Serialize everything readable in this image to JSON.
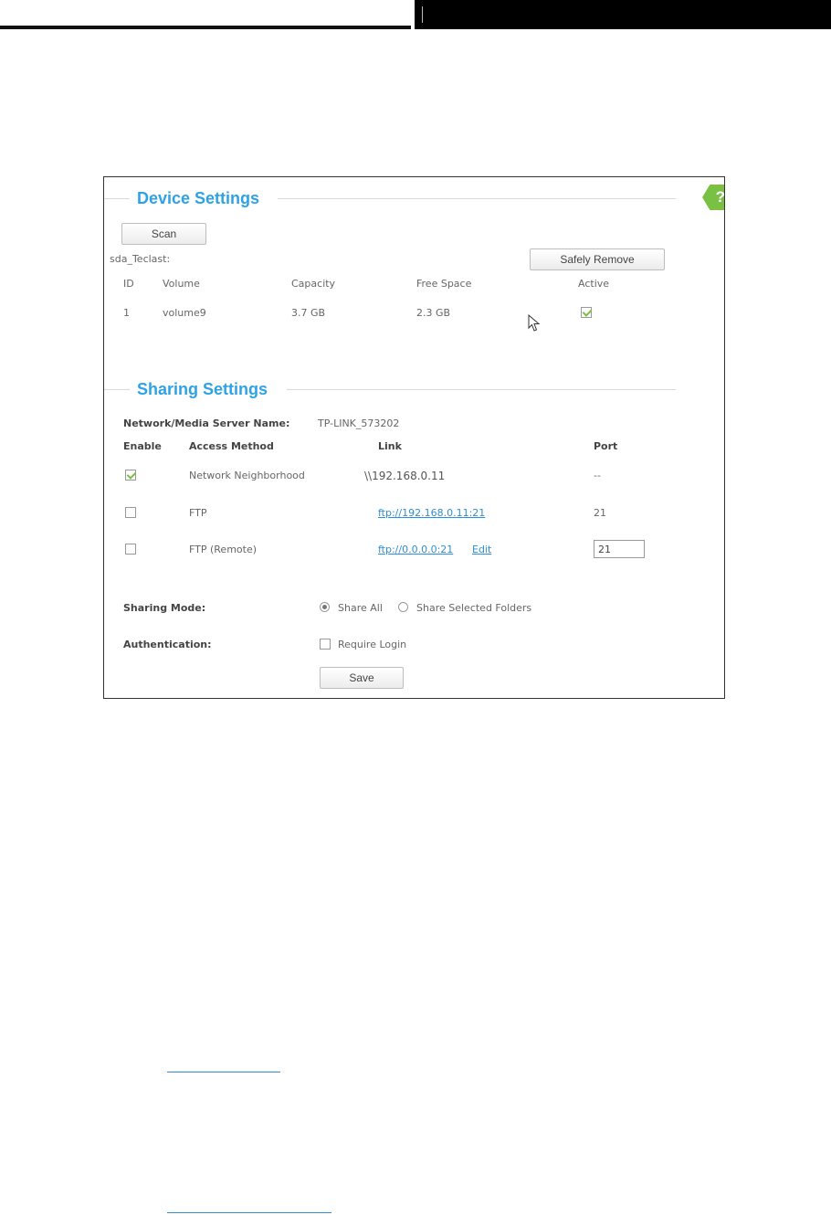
{
  "device_settings": {
    "title": "Device Settings",
    "scan_label": "Scan",
    "device_name": "sda_Teclast:",
    "safely_remove_label": "Safely Remove",
    "columns": {
      "id": "ID",
      "volume": "Volume",
      "capacity": "Capacity",
      "free_space": "Free Space",
      "active": "Active"
    },
    "rows": [
      {
        "id": "1",
        "volume": "volume9",
        "capacity": "3.7 GB",
        "free_space": "2.3 GB",
        "active": true
      }
    ]
  },
  "sharing_settings": {
    "title": "Sharing Settings",
    "server_name_label": "Network/Media Server Name:",
    "server_name_value": "TP-LINK_573202",
    "columns": {
      "enable": "Enable",
      "access_method": "Access Method",
      "link": "Link",
      "port": "Port"
    },
    "rows": [
      {
        "enabled": true,
        "method": "Network Neighborhood",
        "link": "\\\\192.168.0.11",
        "port": "--"
      },
      {
        "enabled": false,
        "method": "FTP",
        "link": "ftp://192.168.0.11:21",
        "port": "21"
      },
      {
        "enabled": false,
        "method": "FTP (Remote)",
        "link": "ftp://0.0.0.0:21",
        "edit_label": "Edit",
        "port": "21"
      }
    ],
    "sharing_mode_label": "Sharing Mode:",
    "sharing_mode_options": [
      "Share All",
      "Share Selected Folders"
    ],
    "sharing_mode_selected": "Share All",
    "authentication_label": "Authentication:",
    "require_login_label": "Require Login",
    "require_login_checked": false,
    "save_label": "Save"
  },
  "colors": {
    "accent": "#2ea2e6",
    "check": "#7ac043",
    "link": "#2e8fd6"
  },
  "icons": [
    "help-icon",
    "check-icon",
    "cursor-icon"
  ]
}
